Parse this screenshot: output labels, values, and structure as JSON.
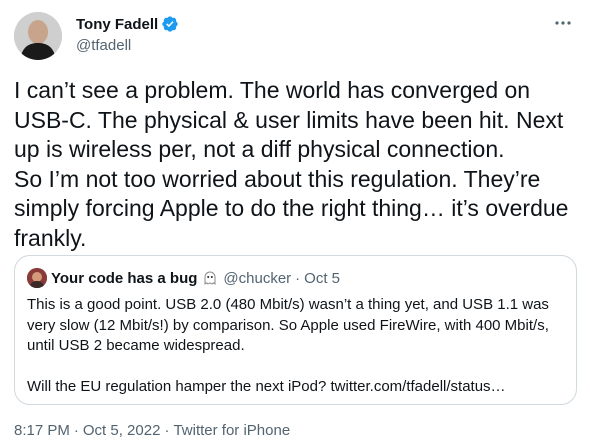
{
  "author": {
    "display_name": "Tony Fadell",
    "handle": "@tfadell",
    "verified_icon": "verified-badge-icon",
    "avatar_icon": "avatar"
  },
  "more_icon": "more-horizontal-icon",
  "tweet": {
    "text": "I can’t see a problem. The world has converged on\nUSB-C. The physical & user limits have been hit. Next\nup is wireless per, not a diff physical connection.\nSo I’m not too worried about this regulation. They’re\nsimply forcing Apple to do the right thing… it’s overdue\nfrankly."
  },
  "quote": {
    "display_name": "Your code has a bug",
    "emoji_icon": "ghost-emoji-icon",
    "handle": "@chucker",
    "dot": "·",
    "date": "Oct 5",
    "text": "This is a good point. USB 2.0 (480 Mbit/s) wasn’t a thing yet, and USB 1.1 was\nvery slow (12 Mbit/s!) by comparison. So Apple used FireWire, with 400 Mbit/s,\nuntil USB 2 became widespread.\n\nWill the EU regulation hamper the next iPod? twitter.com/tfadell/status…"
  },
  "meta": {
    "time": "8:17 PM",
    "sep1": "·",
    "date": "Oct 5, 2022",
    "sep2": "·",
    "source": "Twitter for iPhone"
  },
  "colors": {
    "text": "#0f1419",
    "secondary": "#536471",
    "verified": "#1d9bf0",
    "border": "#cfd9de"
  }
}
